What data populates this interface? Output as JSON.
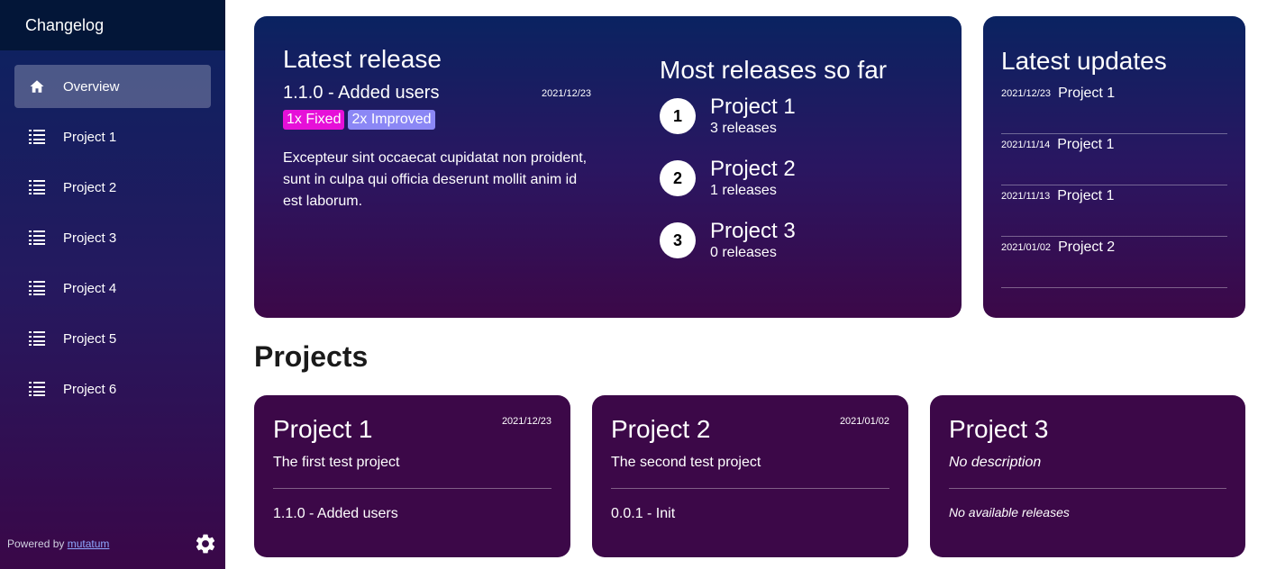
{
  "sidebar": {
    "title": "Changelog",
    "items": [
      {
        "label": "Overview",
        "icon": "home-icon"
      },
      {
        "label": "Project 1",
        "icon": "list-icon"
      },
      {
        "label": "Project 2",
        "icon": "list-icon"
      },
      {
        "label": "Project 3",
        "icon": "list-icon"
      },
      {
        "label": "Project 4",
        "icon": "list-icon"
      },
      {
        "label": "Project 5",
        "icon": "list-icon"
      },
      {
        "label": "Project 6",
        "icon": "list-icon"
      }
    ],
    "powered_prefix": "Powered by",
    "powered_link": "mutatum",
    "settings_icon": "gear-icon"
  },
  "latest_release": {
    "title": "Latest release",
    "version": "1.1.0 - Added users",
    "date": "2021/12/23",
    "tags": {
      "fixed": "1x Fixed",
      "improved": "2x Improved"
    },
    "description": "Excepteur sint occaecat cupidatat non proident, sunt in culpa qui officia deserunt mollit anim id est laborum."
  },
  "most_releases": {
    "title": "Most releases so far",
    "ranks": [
      {
        "num": "1",
        "name": "Project 1",
        "count": "3 releases"
      },
      {
        "num": "2",
        "name": "Project 2",
        "count": "1 releases"
      },
      {
        "num": "3",
        "name": "Project 3",
        "count": "0 releases"
      }
    ]
  },
  "latest_updates": {
    "title": "Latest updates",
    "rows": [
      {
        "date": "2021/12/23",
        "project": "Project 1"
      },
      {
        "date": "2021/11/14",
        "project": "Project 1"
      },
      {
        "date": "2021/11/13",
        "project": "Project 1"
      },
      {
        "date": "2021/01/02",
        "project": "Project 2"
      }
    ]
  },
  "projects": {
    "heading": "Projects",
    "cards": [
      {
        "name": "Project 1",
        "date": "2021/12/23",
        "description": "The first test project",
        "release": "1.1.0 - Added users"
      },
      {
        "name": "Project 2",
        "date": "2021/01/02",
        "description": "The second test project",
        "release": "0.0.1 - Init"
      },
      {
        "name": "Project 3",
        "date": "",
        "description": "No description",
        "release": "No available releases"
      }
    ]
  },
  "colors": {
    "sidebar_top": "#0a2360",
    "sidebar_bottom": "#3a0748",
    "card_purple": "#3c0848",
    "tag_fixed": "#e610d8",
    "tag_improved": "#8b87f5"
  }
}
